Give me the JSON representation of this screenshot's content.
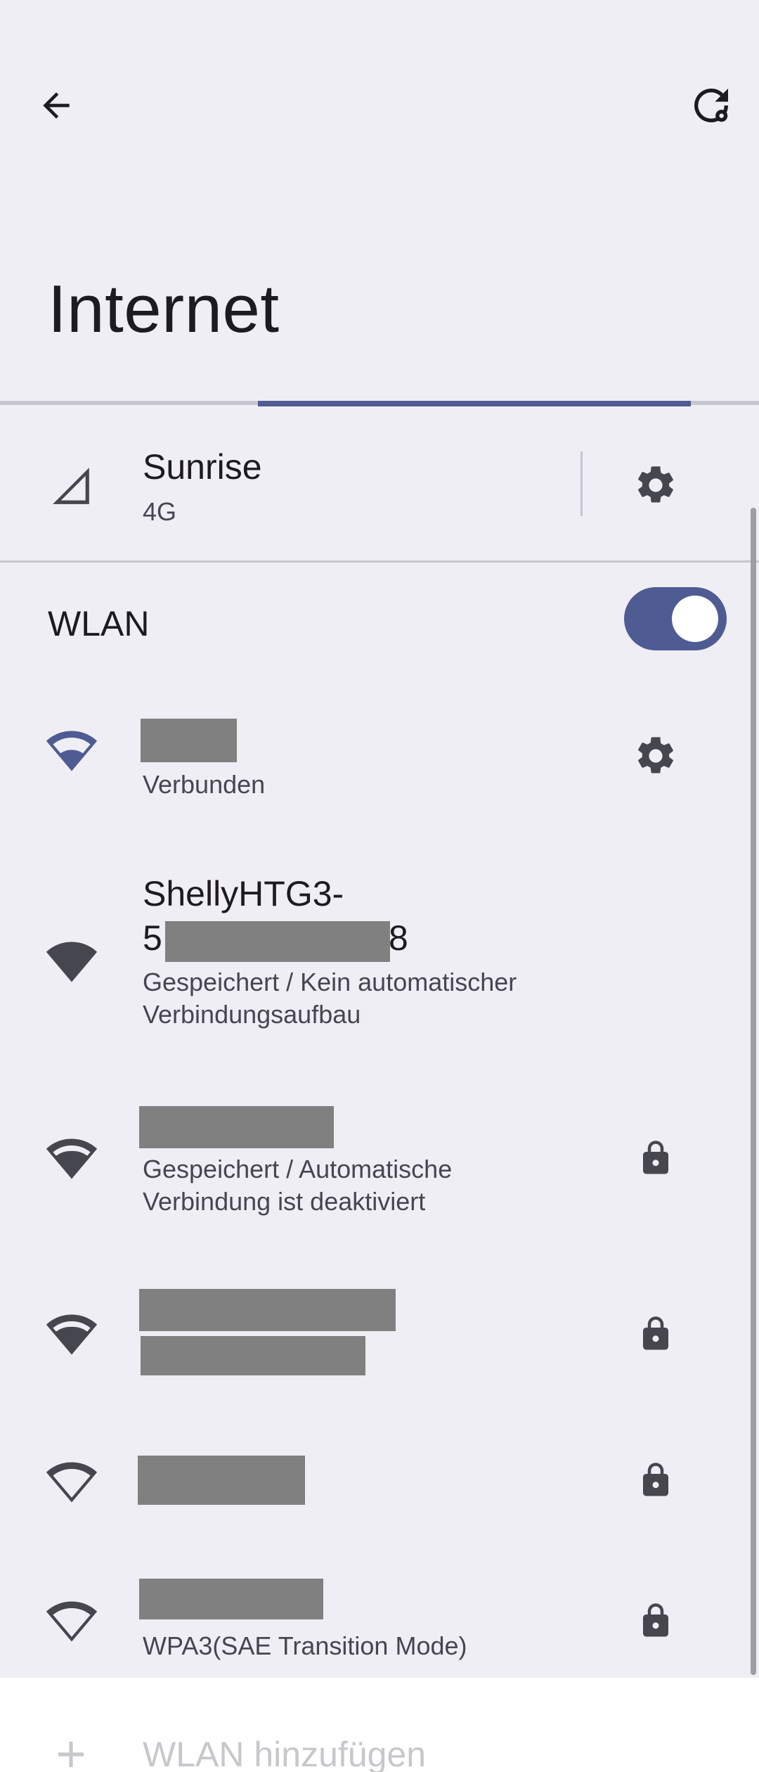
{
  "header": {
    "back_icon": "arrow-back-icon",
    "refresh_icon": "refresh-settings-icon",
    "title": "Internet"
  },
  "loading": {
    "progress_start": 0.34,
    "progress_end": 0.91
  },
  "mobile": {
    "icon": "cellular-signal-icon",
    "carrier": "Sunrise",
    "type": "4G",
    "settings_icon": "gear-icon"
  },
  "wlan": {
    "label": "WLAN",
    "enabled": true
  },
  "networks": [
    {
      "status": "Verbunden",
      "signal": "wifi-strong-connected-icon",
      "action_icon": "gear-icon"
    },
    {
      "name_line1": "ShellyHTG3-",
      "name_prefix": "5",
      "name_suffix": "8",
      "status_line1": "Gespeichert / Kein automatischer",
      "status_line2": "Verbindungsaufbau",
      "signal": "wifi-full-icon"
    },
    {
      "status_line1": "Gespeichert / Automatische",
      "status_line2": "Verbindung ist deaktiviert",
      "signal": "wifi-strong-icon",
      "lock_icon": "lock-icon"
    },
    {
      "signal": "wifi-strong-icon",
      "lock_icon": "lock-icon"
    },
    {
      "signal": "wifi-outline-icon",
      "lock_icon": "lock-icon"
    },
    {
      "security": "WPA3(SAE Transition Mode)",
      "signal": "wifi-outline-icon",
      "lock_icon": "lock-icon"
    }
  ],
  "add_network": {
    "icon": "plus-icon",
    "label": "WLAN hinzufügen"
  },
  "colors": {
    "accent": "#4f5c93",
    "background": "#efeef4",
    "icon_dark": "#46464f"
  }
}
